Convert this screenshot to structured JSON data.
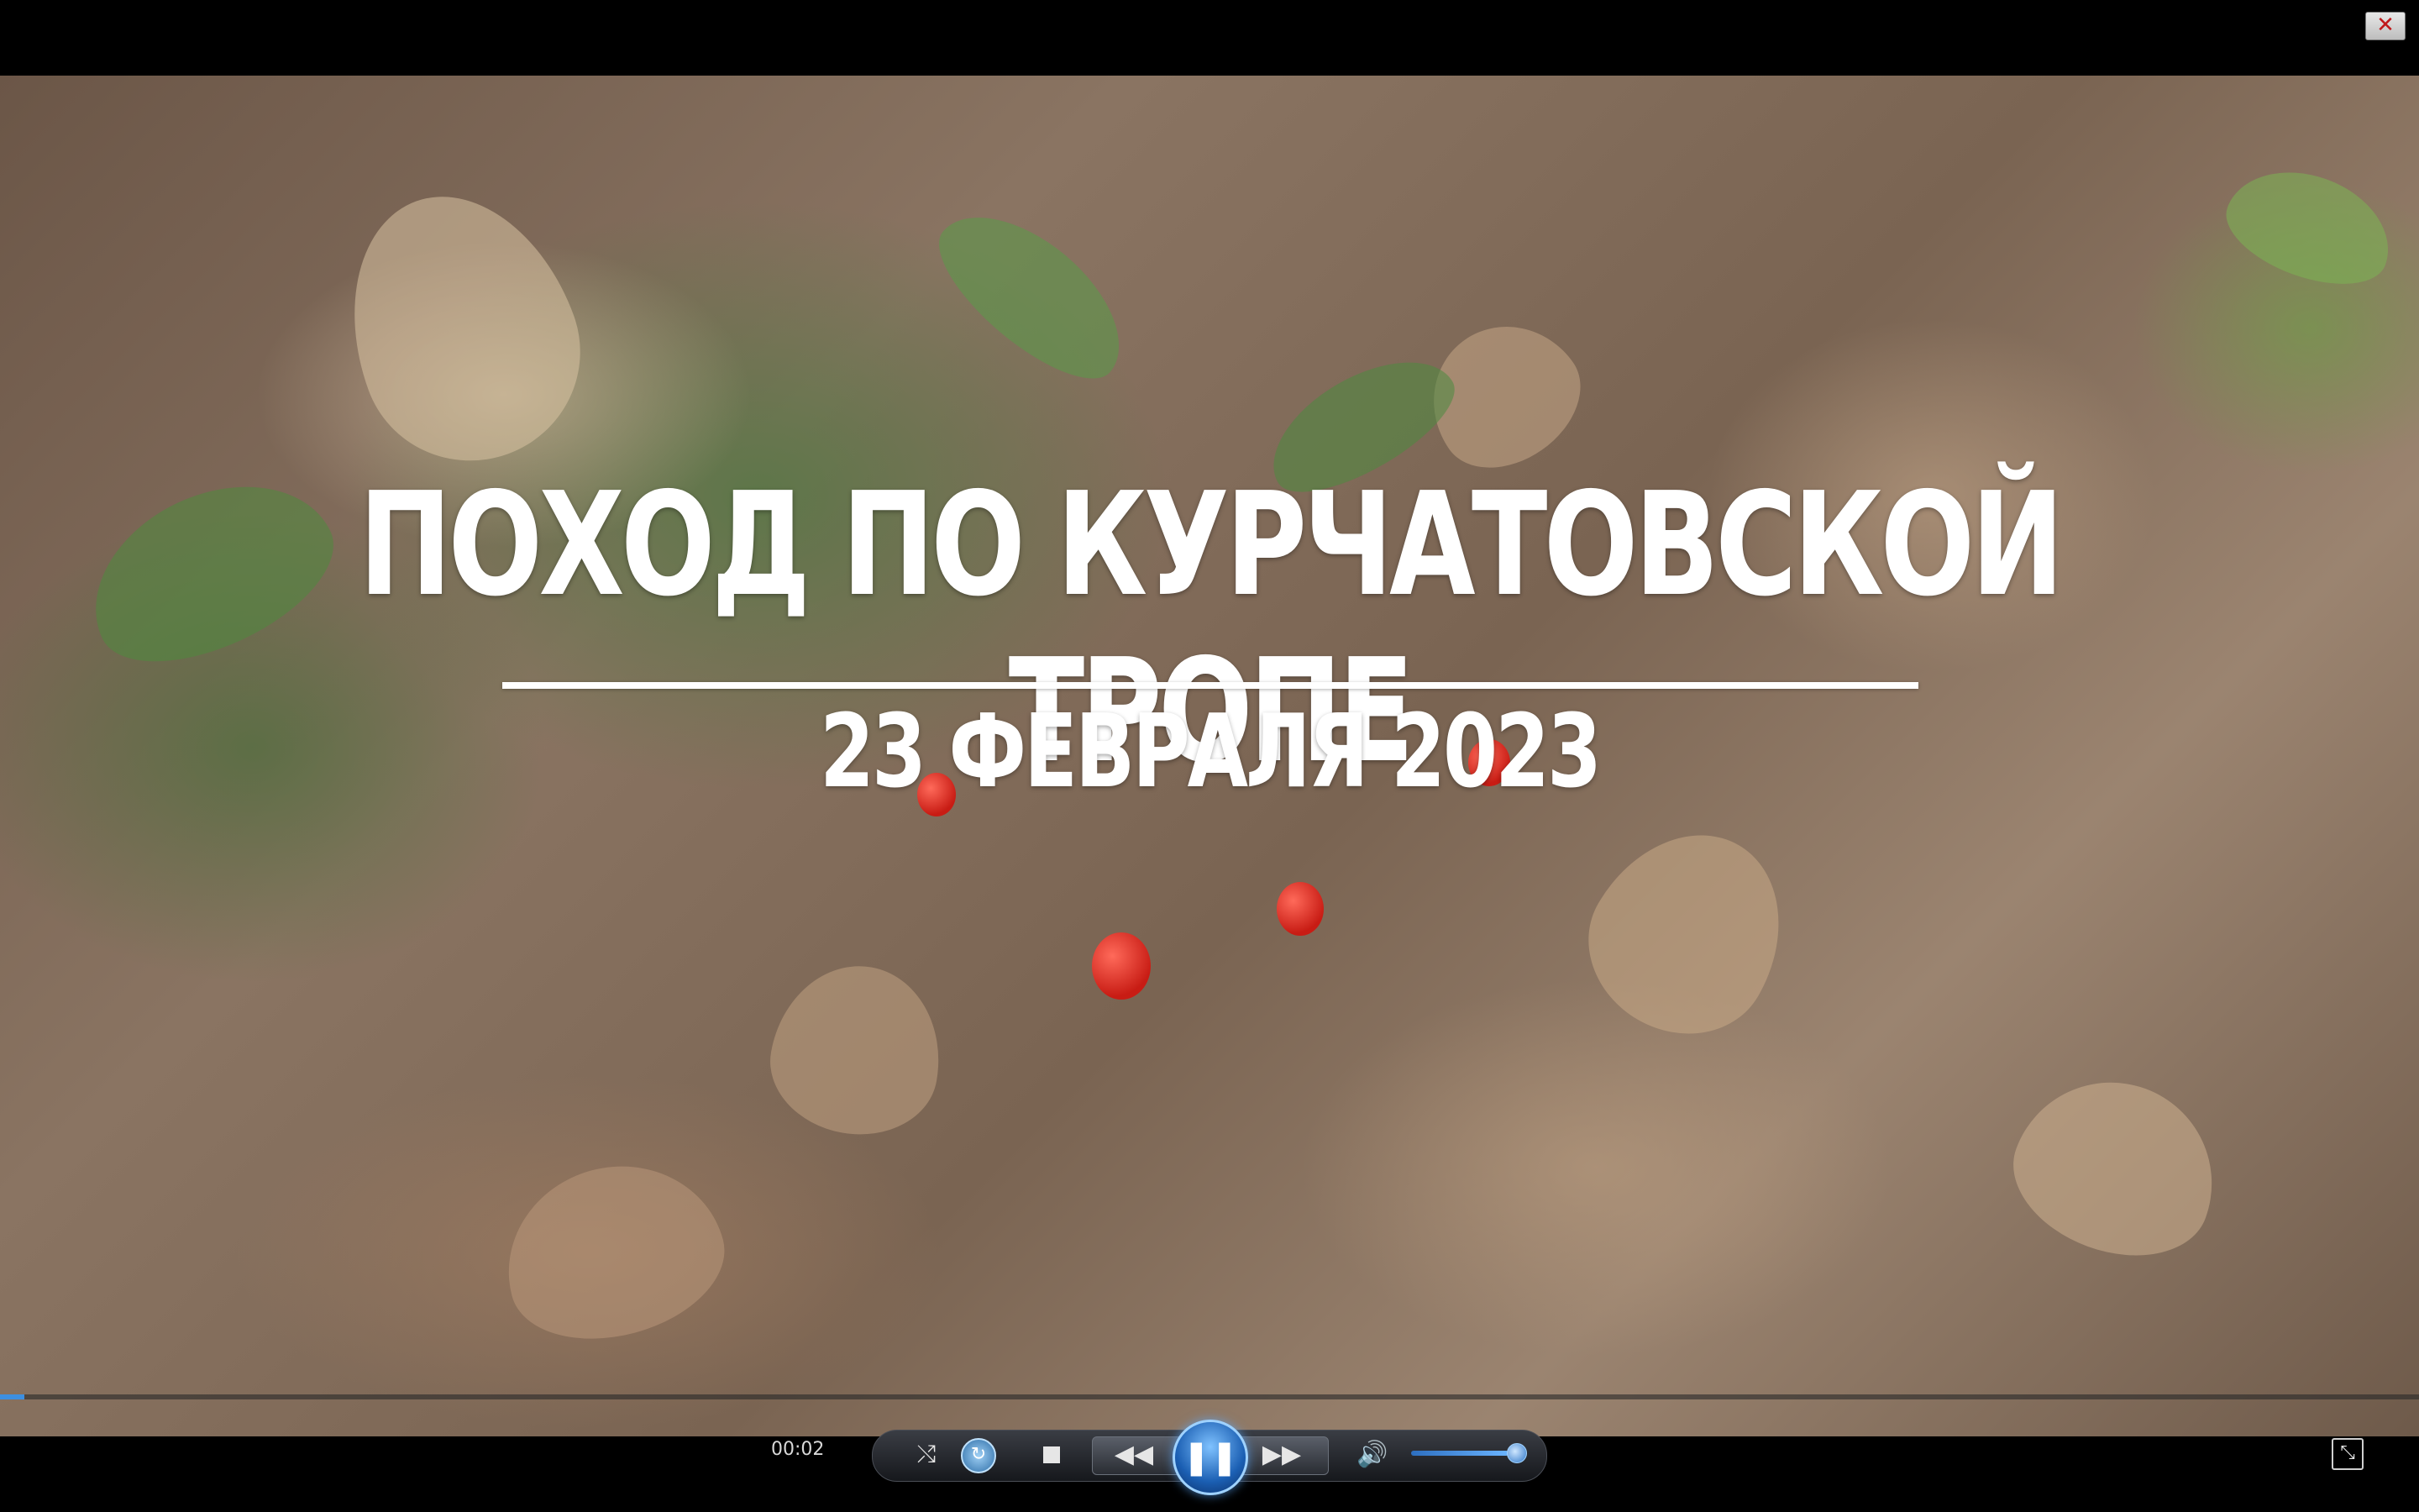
{
  "window": {
    "close_icon": "close-icon",
    "close_glyph": "✕"
  },
  "video": {
    "title": "ПОХОД ПО КУРЧАТОВСКОЙ ТРОПЕ",
    "subtitle": "23 ФЕВРАЛЯ 2023"
  },
  "playback": {
    "elapsed": "00:02",
    "progress_fraction": 0.01,
    "volume_fraction": 0.85,
    "state": "playing"
  },
  "controls": {
    "shuffle_icon": "shuffle-icon",
    "shuffle_glyph": "⤭",
    "repeat_icon": "repeat-icon",
    "repeat_glyph": "↻",
    "stop_icon": "stop-icon",
    "prev_icon": "rewind-icon",
    "prev_glyph": "◀◀",
    "play_icon": "pause-icon",
    "play_glyph": "❚❚",
    "next_icon": "fast-forward-icon",
    "next_glyph": "▶▶",
    "volume_icon": "speaker-icon",
    "volume_glyph": "🔊",
    "switch_icon": "switch-to-library-icon",
    "switch_glyph": "⤡"
  },
  "colors": {
    "accent": "#3d8fe0",
    "title_text": "#ffffff"
  }
}
